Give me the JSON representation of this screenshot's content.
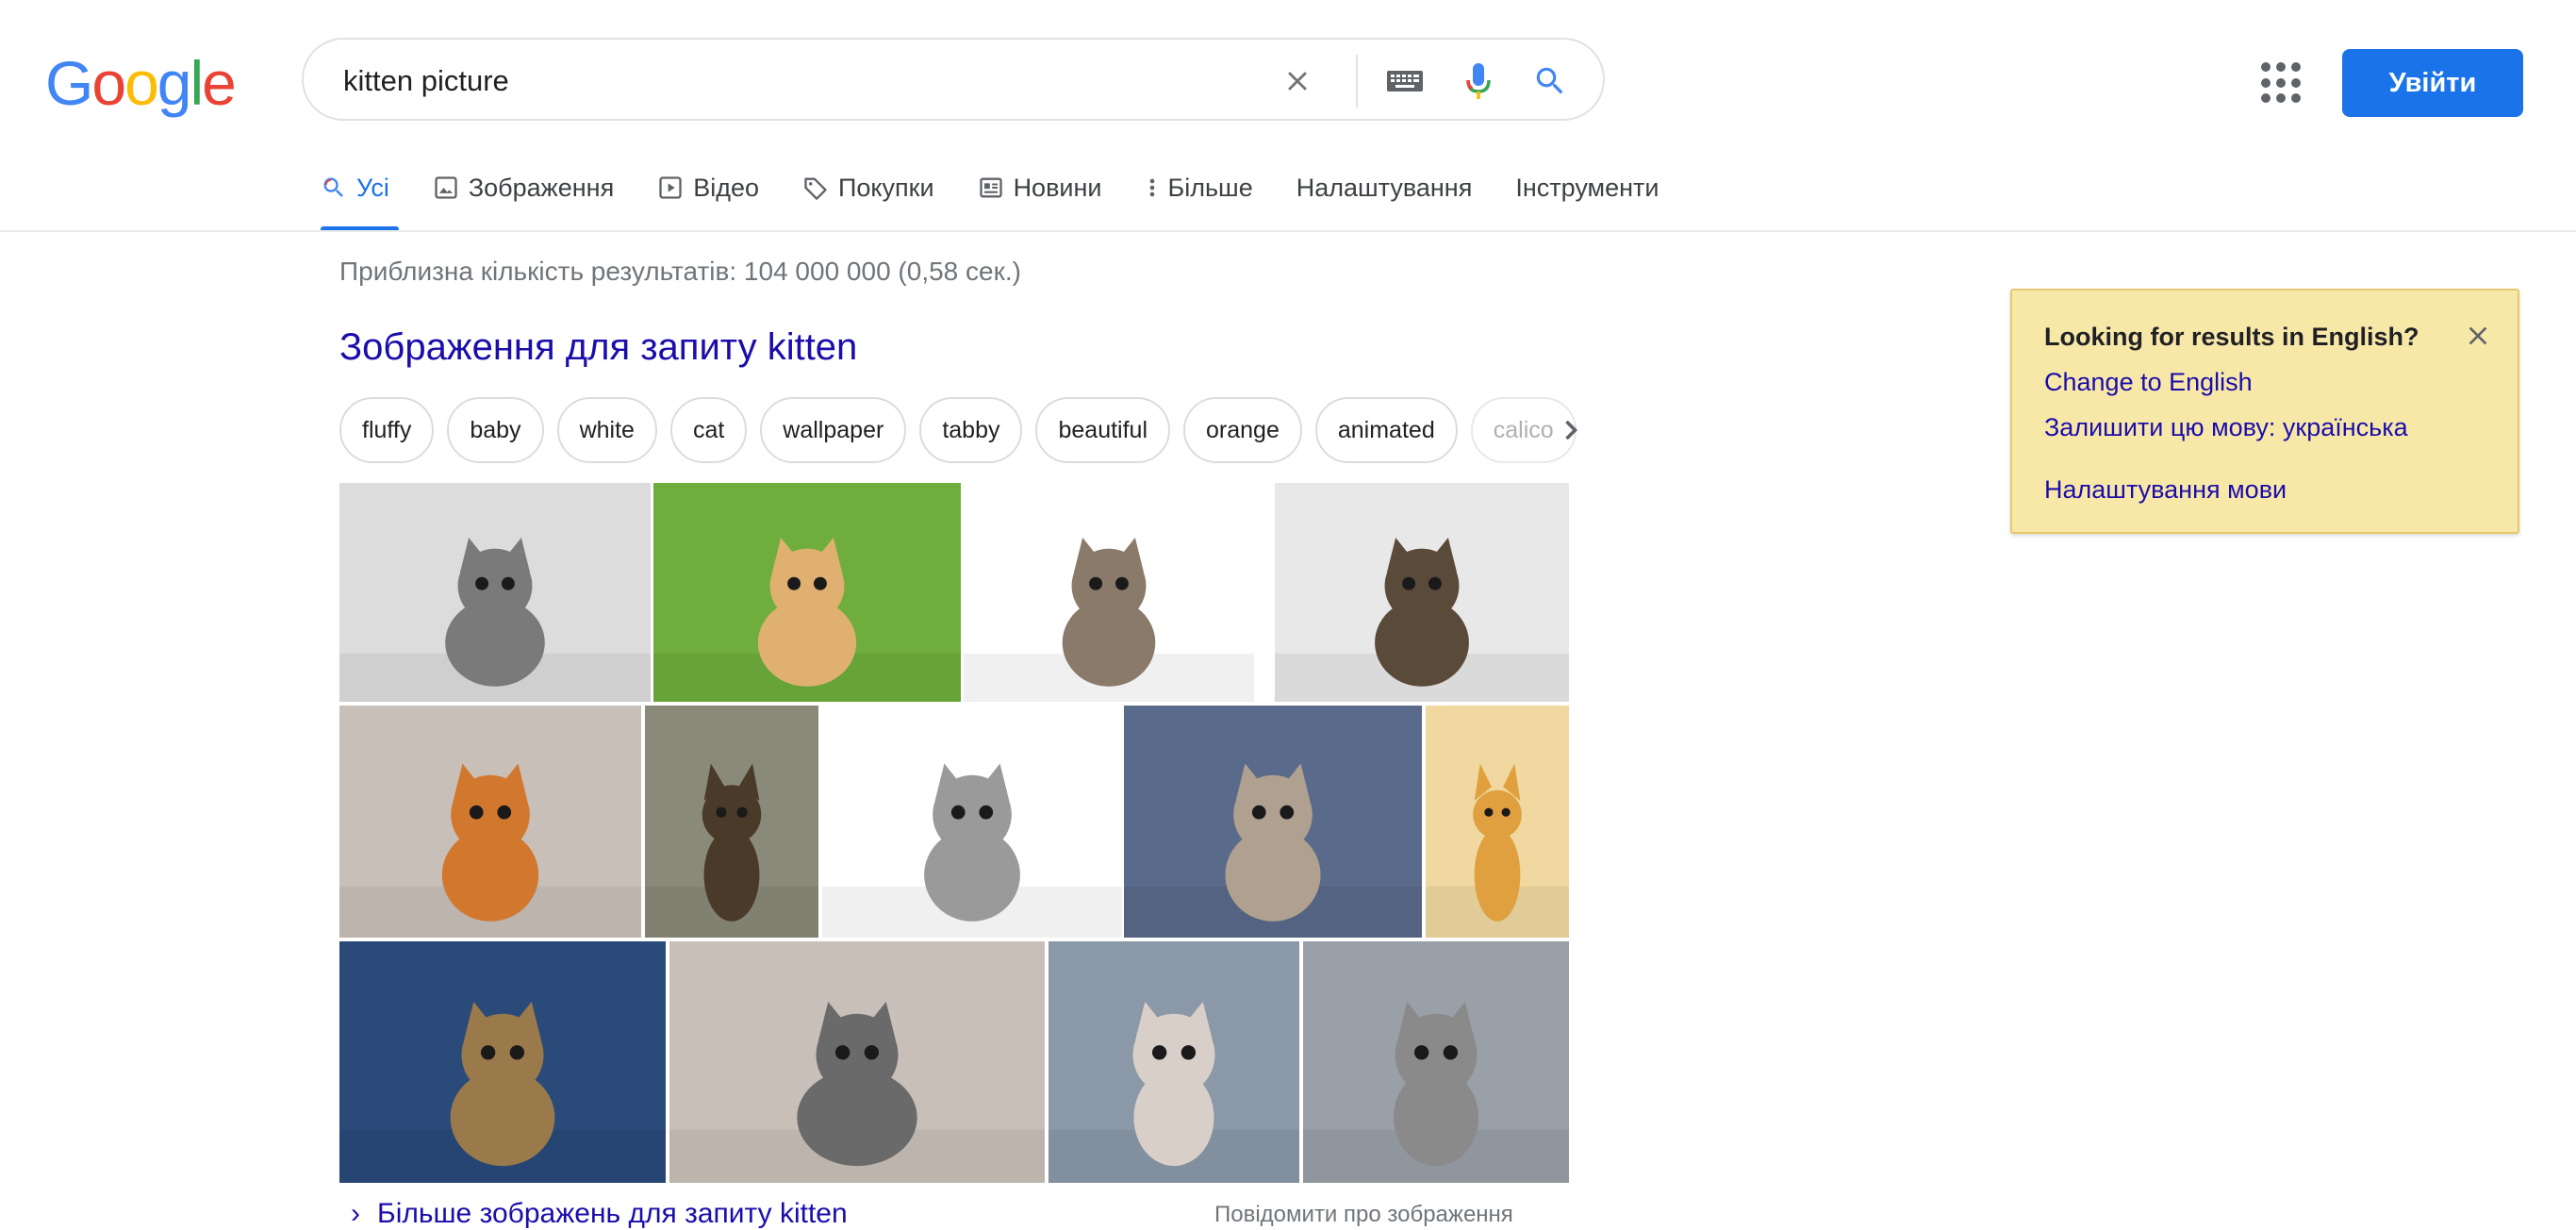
{
  "header": {
    "logo_letters": [
      {
        "char": "G",
        "color": "#4285f4"
      },
      {
        "char": "o",
        "color": "#ea4335"
      },
      {
        "char": "o",
        "color": "#fbbc05"
      },
      {
        "char": "g",
        "color": "#4285f4"
      },
      {
        "char": "l",
        "color": "#34a853"
      },
      {
        "char": "e",
        "color": "#ea4335"
      }
    ],
    "search": {
      "value": "kitten picture",
      "clear_icon": "close-icon",
      "keyboard_icon": "keyboard-icon",
      "mic_icon": "microphone-icon",
      "search_icon": "search-icon"
    },
    "apps_icon": "apps-grid-icon",
    "signin_label": "Увійти"
  },
  "tabs": [
    {
      "label": "Усі",
      "icon": "search-icon",
      "active": true
    },
    {
      "label": "Зображення",
      "icon": "image-icon",
      "active": false
    },
    {
      "label": "Відео",
      "icon": "video-icon",
      "active": false
    },
    {
      "label": "Покупки",
      "icon": "tag-icon",
      "active": false
    },
    {
      "label": "Новини",
      "icon": "news-icon",
      "active": false
    },
    {
      "label": "Більше",
      "icon": "more-vert-icon",
      "active": false
    },
    {
      "label": "Налаштування",
      "icon": "",
      "active": false
    },
    {
      "label": "Інструменти",
      "icon": "",
      "active": false
    }
  ],
  "results": {
    "stats": "Приблизна кількість результатів: 104 000 000 (0,58 сек.)",
    "images_heading": "Зображення для запиту kitten",
    "chips": [
      "fluffy",
      "baby",
      "white",
      "cat",
      "wallpaper",
      "tabby",
      "beautiful",
      "orange",
      "animated",
      "calico"
    ],
    "more_images": "Більше зображень для запиту kitten",
    "report_images": "Повідомити про зображення"
  },
  "language_popup": {
    "question": "Looking for results in English?",
    "change_link": "Change to English",
    "keep_link": "Залишити цю мову: українська",
    "settings_link": "Налаштування мови"
  },
  "colors": {
    "accent": "#1a73e8",
    "link": "#1a0dab",
    "popup_bg": "#f8e8a8"
  }
}
